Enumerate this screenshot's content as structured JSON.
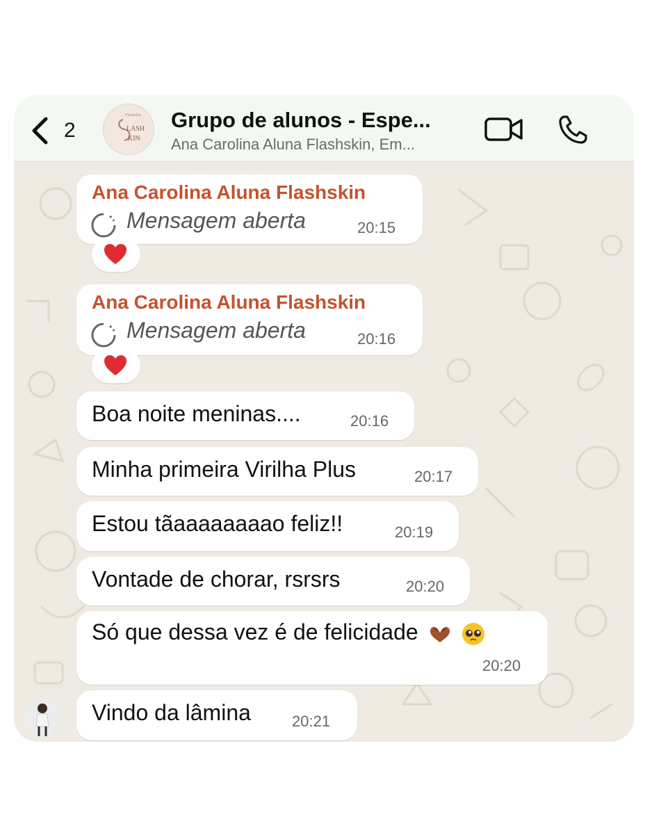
{
  "header": {
    "back_count": "2",
    "group_title": "Grupo de alunos - Espe...",
    "group_subtitle": "Ana Carolina Aluna Flashskin, Em...",
    "group_avatar_text_top": "LASH",
    "group_avatar_text_bottom": "KIN"
  },
  "messages": [
    {
      "sender": "Ana Carolina Aluna Flashskin",
      "text": "Mensagem aberta",
      "time": "20:15",
      "reaction": "heart"
    },
    {
      "sender": "Ana Carolina Aluna Flashskin",
      "text": "Mensagem aberta",
      "time": "20:16",
      "reaction": "heart"
    },
    {
      "text": "Boa noite meninas....",
      "time": "20:16"
    },
    {
      "text": "Minha primeira Virilha Plus",
      "time": "20:17"
    },
    {
      "text": "Estou tãaaaaaaaao feliz!!",
      "time": "20:19"
    },
    {
      "text": "Vontade de chorar,  rsrsrs",
      "time": "20:20"
    },
    {
      "text": "Só que dessa vez é de felicidade",
      "time": "20:20",
      "emojis": [
        "heart-hands",
        "pleading-face"
      ]
    },
    {
      "text": "Vindo da lâmina",
      "time": "20:21"
    }
  ],
  "colors": {
    "sender_name": "#c4532e",
    "header_bg": "#f3f9f2",
    "chat_bg": "#efeae2",
    "bubble_bg": "#ffffff"
  }
}
